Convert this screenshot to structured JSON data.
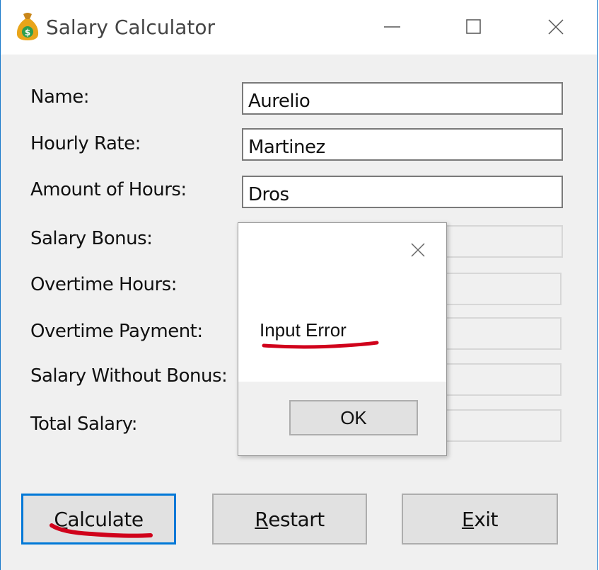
{
  "window": {
    "title": "Salary Calculator"
  },
  "form": {
    "labels": [
      "Name:",
      "Hourly Rate:",
      "Amount of Hours:",
      "Salary Bonus:",
      "Overtime Hours:",
      "Overtime Payment:",
      "Salary Without Bonus:",
      "Total Salary:"
    ],
    "name_value": "Aurelio",
    "hourly_rate_value": "Martinez",
    "hours_value": "Dros"
  },
  "buttons": {
    "calculate_accel": "C",
    "calculate_rest": "alculate",
    "restart_accel": "R",
    "restart_rest": "estart",
    "exit_accel": "E",
    "exit_rest": "xit"
  },
  "dialog": {
    "message": "Input Error",
    "ok_label": "OK"
  },
  "colors": {
    "focus": "#0078d7",
    "annotation": "#d0021b",
    "icon_bag": "#e9a51a",
    "icon_coin": "#2e9e4f"
  }
}
